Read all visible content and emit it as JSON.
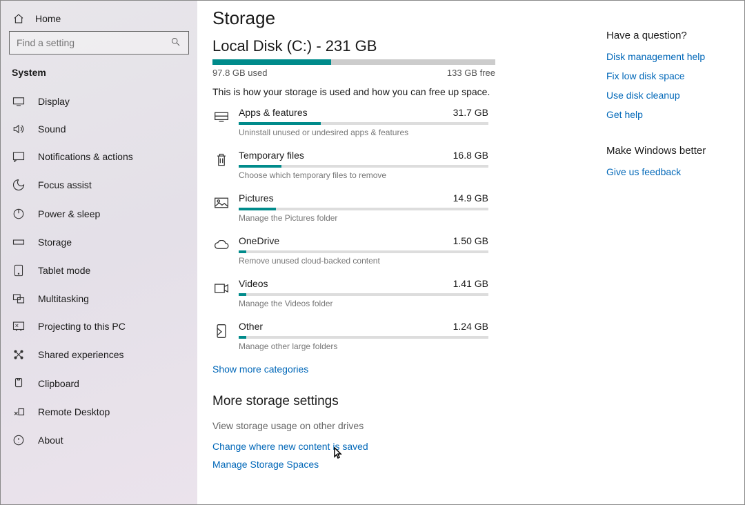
{
  "sidebar": {
    "home": "Home",
    "search_placeholder": "Find a setting",
    "section": "System",
    "items": [
      {
        "label": "Display"
      },
      {
        "label": "Sound"
      },
      {
        "label": "Notifications & actions"
      },
      {
        "label": "Focus assist"
      },
      {
        "label": "Power & sleep"
      },
      {
        "label": "Storage"
      },
      {
        "label": "Tablet mode"
      },
      {
        "label": "Multitasking"
      },
      {
        "label": "Projecting to this PC"
      },
      {
        "label": "Shared experiences"
      },
      {
        "label": "Clipboard"
      },
      {
        "label": "Remote Desktop"
      },
      {
        "label": "About"
      }
    ]
  },
  "page": {
    "title": "Storage",
    "disk_title": "Local Disk (C:) - 231 GB",
    "used": "97.8 GB used",
    "free": "133 GB free",
    "used_pct": 42,
    "description": "This is how your storage is used and how you can free up space.",
    "categories": [
      {
        "name": "Apps & features",
        "size": "31.7 GB",
        "pct": 33,
        "hint": "Uninstall unused or undesired apps & features"
      },
      {
        "name": "Temporary files",
        "size": "16.8 GB",
        "pct": 17,
        "hint": "Choose which temporary files to remove"
      },
      {
        "name": "Pictures",
        "size": "14.9 GB",
        "pct": 15,
        "hint": "Manage the Pictures folder"
      },
      {
        "name": "OneDrive",
        "size": "1.50 GB",
        "pct": 3,
        "hint": "Remove unused cloud-backed content"
      },
      {
        "name": "Videos",
        "size": "1.41 GB",
        "pct": 3,
        "hint": "Manage the Videos folder"
      },
      {
        "name": "Other",
        "size": "1.24 GB",
        "pct": 3,
        "hint": "Manage other large folders"
      }
    ],
    "show_more": "Show more categories",
    "more_title": "More storage settings",
    "more_links": [
      "View storage usage on other drives",
      "Change where new content is saved",
      "Manage Storage Spaces"
    ]
  },
  "right": {
    "question_title": "Have a question?",
    "question_links": [
      "Disk management help",
      "Fix low disk space",
      "Use disk cleanup",
      "Get help"
    ],
    "feedback_title": "Make Windows better",
    "feedback_link": "Give us feedback"
  }
}
